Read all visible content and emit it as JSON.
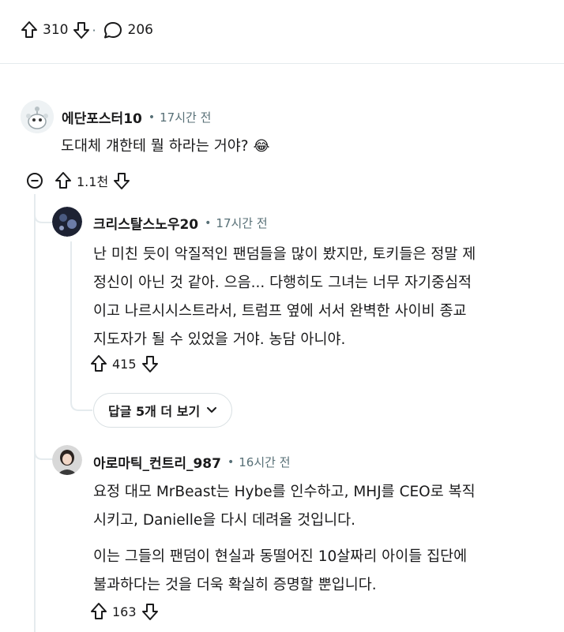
{
  "post_actions": {
    "upvotes": "310",
    "dot": "·",
    "comments": "206"
  },
  "comments": [
    {
      "author": "에단포스터10",
      "separator": "•",
      "time": "17시간 전",
      "text": "도대체 걔한테 뭘 하라는 거야?",
      "emoji": "😂",
      "votes": "1.1천"
    },
    {
      "author": "크리스탈스노우20",
      "separator": "•",
      "time": "17시간 전",
      "lines": [
        "난 미친 듯이 악질적인 팬덤들을 많이 봤지만, 토키들은 정말 제",
        "정신이 아닌 것 같아. 으음... 다행히도 그녀는 너무 자기중심적",
        "이고 나르시시스트라서, 트럼프 옆에 서서 완벽한 사이비 종교",
        "지도자가 될 수 있었을 거야. 농담 아니야."
      ],
      "votes": "415",
      "more_replies": "답글 5개 더 보기"
    },
    {
      "author": "아로마틱_컨트리_987",
      "separator": "•",
      "time": "16시간 전",
      "para1": [
        "요정 대모 MrBeast는 Hybe를 인수하고, MHJ를 CEO로 복직",
        "시키고, Danielle을 다시 데려올 것입니다."
      ],
      "para2": [
        "이는 그들의 팬덤이 현실과 동떨어진 10살짜리 아이들 집단에",
        "불과하다는 것을 더욱 확실히 증명할 뿐입니다."
      ],
      "votes": "163"
    }
  ],
  "icons": {
    "upvote": "arrow-up-outline",
    "downvote": "arrow-down-outline",
    "comment": "speech-bubble",
    "collapse": "minus-circle",
    "chevron": "chevron-down"
  },
  "colors": {
    "text": "#1a1a1b",
    "meta": "#576f76",
    "divider": "#e5ebee"
  }
}
